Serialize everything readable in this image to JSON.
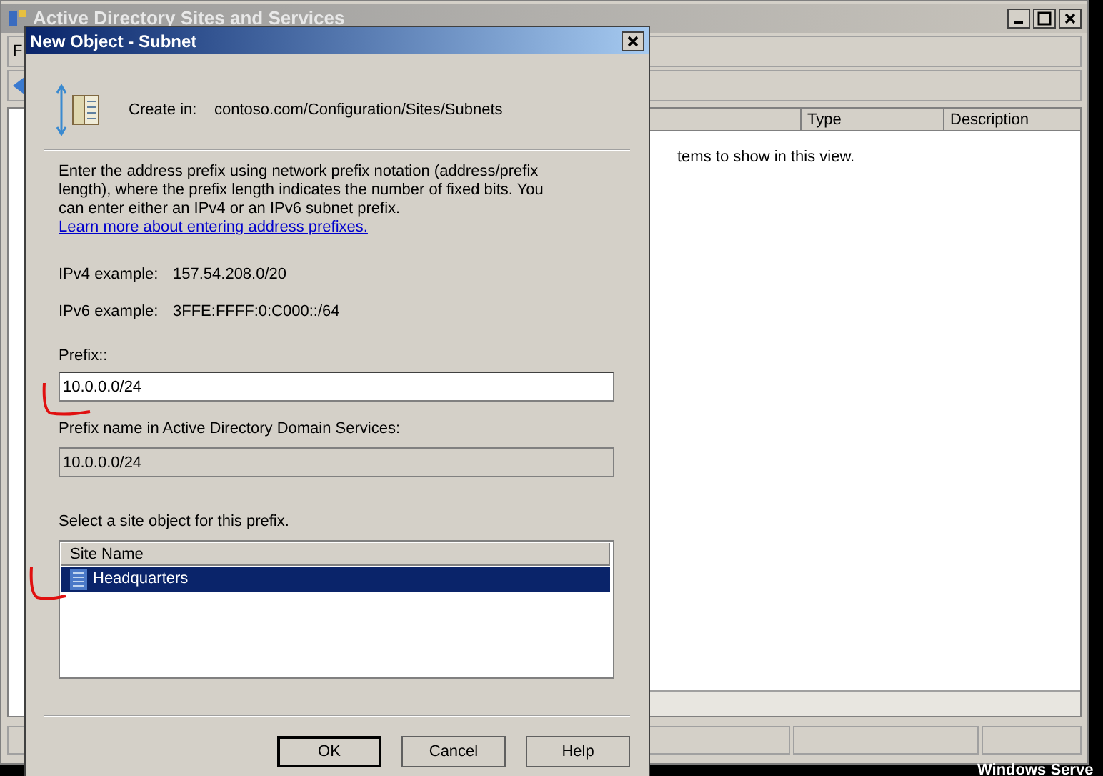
{
  "main_window": {
    "title": "Active Directory Sites and Services",
    "menu": [
      "F"
    ],
    "columns": [
      "Type",
      "Description"
    ],
    "empty_message": "tems to show in this view."
  },
  "dialog": {
    "title": "New Object - Subnet",
    "create_in_label": "Create in:",
    "create_in_path": "contoso.com/Configuration/Sites/Subnets",
    "description": "Enter the address prefix using network prefix notation (address/prefix length), where the prefix length indicates the number of fixed bits. You can enter either an IPv4 or an IPv6 subnet prefix.",
    "link": "Learn more about entering address prefixes.",
    "examples": [
      {
        "label": "IPv4 example:",
        "value": "157.54.208.0/20"
      },
      {
        "label": "IPv6 example:",
        "value": "3FFE:FFFF:0:C000::/64"
      }
    ],
    "prefix_label": "Prefix::",
    "prefix_value": "10.0.0.0/24",
    "prefix_name_label": "Prefix name in Active Directory Domain Services:",
    "prefix_name_value": "10.0.0.0/24",
    "site_label": "Select a site object for this prefix.",
    "site_list": {
      "column": "Site Name",
      "rows": [
        {
          "name": "Headquarters",
          "selected": true
        }
      ]
    },
    "buttons": [
      {
        "label": "OK",
        "default": true
      },
      {
        "label": "Cancel",
        "default": false
      },
      {
        "label": "Help",
        "default": false
      }
    ]
  },
  "desktop_text": "Windows Serve"
}
